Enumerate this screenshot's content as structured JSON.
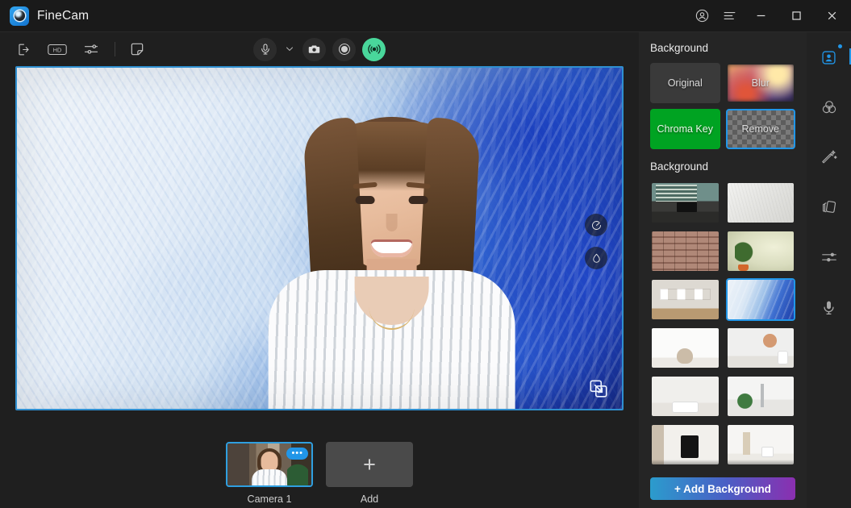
{
  "window": {
    "app_name": "FineCam",
    "logo_icon": "camera-lens-icon",
    "account_icon": "account-circle-icon",
    "menu_icon": "hamburger-menu-icon",
    "minimize_icon": "minimize-icon",
    "maximize_icon": "maximize-icon",
    "close_icon": "close-icon"
  },
  "toolbar": {
    "left_tools": [
      {
        "name": "export-output-icon",
        "label": "Export"
      },
      {
        "name": "hd-quality-icon",
        "label": "HD"
      },
      {
        "name": "settings-sliders-icon",
        "label": "Settings"
      },
      {
        "name": "whiteboard-note-icon",
        "label": "Notes"
      }
    ],
    "center_tools": [
      {
        "name": "microphone-icon",
        "label": "Microphone"
      },
      {
        "name": "chevron-down-icon",
        "label": "Audio device menu"
      },
      {
        "name": "snapshot-camera-icon",
        "label": "Snapshot"
      },
      {
        "name": "record-icon",
        "label": "Record"
      },
      {
        "name": "broadcast-live-icon",
        "label": "Live"
      }
    ]
  },
  "preview": {
    "overlay_buttons": [
      {
        "name": "mirror-flip-icon",
        "label": "Mirror"
      },
      {
        "name": "water-drop-icon",
        "label": "Retouch"
      }
    ],
    "resize_icon": "resize-expand-icon",
    "border_color": "#2f8fd0"
  },
  "cameras": {
    "items": [
      {
        "label": "Camera 1",
        "selected": true,
        "more_badge": "•••"
      }
    ],
    "add_label": "Add",
    "add_icon": "plus-icon"
  },
  "panel": {
    "mode_heading": "Background",
    "modes": [
      {
        "label": "Original",
        "style": "original",
        "selected": false
      },
      {
        "label": "Blur",
        "style": "blur",
        "selected": false
      },
      {
        "label": "Chroma Key",
        "style": "chroma",
        "selected": false
      },
      {
        "label": "Remove",
        "style": "remove",
        "selected": true
      }
    ],
    "library_heading": "Background",
    "backgrounds": [
      {
        "name": "background-office-desk",
        "art": "t-office",
        "selected": false
      },
      {
        "name": "background-white-wall",
        "art": "t-white",
        "selected": false
      },
      {
        "name": "background-brick-wall",
        "art": "t-brick",
        "selected": false
      },
      {
        "name": "background-plant-wall",
        "art": "t-plant",
        "selected": false
      },
      {
        "name": "background-gallery-wall",
        "art": "t-gallery",
        "selected": false
      },
      {
        "name": "background-blue-paint",
        "art": "t-bluepaint",
        "selected": true
      },
      {
        "name": "background-white-room-chair",
        "art": "t-room1",
        "selected": false
      },
      {
        "name": "background-white-room-vase",
        "art": "t-room2",
        "selected": false
      },
      {
        "name": "background-white-room-console",
        "art": "t-room3",
        "selected": false
      },
      {
        "name": "background-bathroom-plant",
        "art": "t-bath",
        "selected": false
      },
      {
        "name": "background-shelf-poster",
        "art": "t-shelf",
        "selected": false
      },
      {
        "name": "background-shelf-decor",
        "art": "t-shelf2",
        "selected": false
      }
    ],
    "add_background_label": "+ Add Background",
    "accent_color": "#2196e8",
    "chroma_color": "#00a322"
  },
  "rail": {
    "items": [
      {
        "name": "rail-portrait",
        "icon": "portrait-person-icon",
        "active": true,
        "badge": true
      },
      {
        "name": "rail-color",
        "icon": "color-circles-icon",
        "active": false,
        "badge": false
      },
      {
        "name": "rail-beauty",
        "icon": "magic-wand-icon",
        "active": false,
        "badge": false
      },
      {
        "name": "rail-cards",
        "icon": "layered-cards-icon",
        "active": false,
        "badge": false
      },
      {
        "name": "rail-adjust",
        "icon": "adjust-sliders-icon",
        "active": false,
        "badge": false
      },
      {
        "name": "rail-audio",
        "icon": "microphone-icon",
        "active": false,
        "badge": false
      }
    ]
  }
}
